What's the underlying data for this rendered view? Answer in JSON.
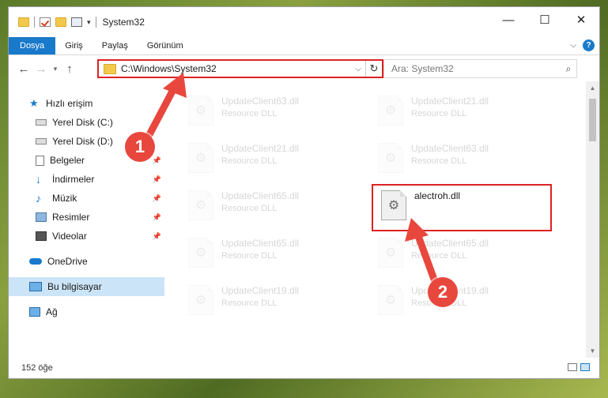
{
  "window": {
    "title": "System32",
    "controls": {
      "minimize": "—",
      "maximize": "☐",
      "close": "✕"
    }
  },
  "ribbon": {
    "tabs": [
      "Dosya",
      "Giriş",
      "Paylaş",
      "Görünüm"
    ],
    "active_tab": "Dosya",
    "help": "?"
  },
  "nav": {
    "address": "C:\\Windows\\System32",
    "search_placeholder": "Ara: System32"
  },
  "sidebar": {
    "items": [
      {
        "label": "Hızlı erişim",
        "icon": "star-icon",
        "pinned": false
      },
      {
        "label": "Yerel Disk (C:)",
        "icon": "drive-icon",
        "pinned": false
      },
      {
        "label": "Yerel Disk (D:)",
        "icon": "drive-icon",
        "pinned": false
      },
      {
        "label": "Belgeler",
        "icon": "documents-icon",
        "pinned": true
      },
      {
        "label": "İndirmeler",
        "icon": "download-icon",
        "pinned": true
      },
      {
        "label": "Müzik",
        "icon": "music-icon",
        "pinned": true
      },
      {
        "label": "Resimler",
        "icon": "pictures-icon",
        "pinned": true
      },
      {
        "label": "Videolar",
        "icon": "videos-icon",
        "pinned": true
      },
      {
        "label": "OneDrive",
        "icon": "cloud-icon",
        "pinned": false
      },
      {
        "label": "Bu bilgisayar",
        "icon": "computer-icon",
        "pinned": false
      },
      {
        "label": "Ağ",
        "icon": "network-icon",
        "pinned": false
      }
    ],
    "selected": "Bu bilgisayar"
  },
  "files": [
    {
      "name": "UpdateClient63.dll",
      "type": "Resource DLL"
    },
    {
      "name": "UpdateClient21.dll",
      "type": "Resource DLL"
    },
    {
      "name": "UpdateClient21.dll",
      "type": "Resource DLL"
    },
    {
      "name": "UpdateClient63.dll",
      "type": "Resource DLL"
    },
    {
      "name": "UpdateClient65.dll",
      "type": "Resource DLL"
    },
    {
      "name": "alectroh.dll",
      "type": ""
    },
    {
      "name": "UpdateClient65.dll",
      "type": "Resource DLL"
    },
    {
      "name": "UpdateClient65.dll",
      "type": "Resource DLL"
    },
    {
      "name": "UpdateClient19.dll",
      "type": "Resource DLL"
    },
    {
      "name": "UpdateClient19.dll",
      "type": "Resource DLL"
    }
  ],
  "highlighted_file": "alectroh.dll",
  "status": {
    "count": "152 öğe"
  },
  "annotations": {
    "step1": "1",
    "step2": "2",
    "color": "#e8473d"
  },
  "colors": {
    "accent": "#1979ca",
    "highlight": "#dd2222",
    "selection": "#cce4f7"
  }
}
